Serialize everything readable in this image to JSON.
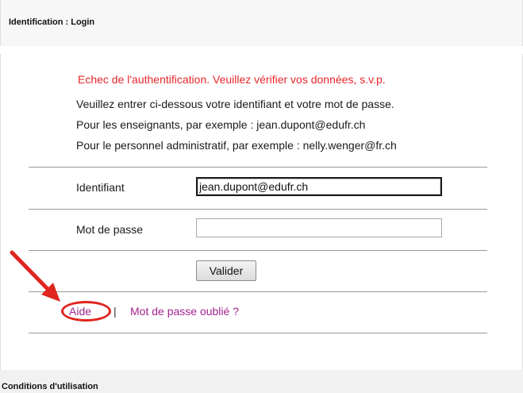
{
  "header": {
    "title": "Identification : Login"
  },
  "messages": {
    "error": "Echec de l'authentification. Veuillez vérifier vos données, s.v.p.",
    "instruction": "Veuillez entrer ci-dessous votre identifiant et votre mot de passe.",
    "example_teachers": "Pour les enseignants, par exemple : jean.dupont@edufr.ch",
    "example_admin": "Pour le personnel administratif, par exemple : nelly.wenger@fr.ch"
  },
  "form": {
    "username_label": "Identifiant",
    "username_value": "jean.dupont@edufr.ch",
    "password_label": "Mot de passe",
    "password_value": "",
    "submit_label": "Valider"
  },
  "links": {
    "help": "Aide",
    "separator": "|",
    "forgot_password": "Mot de passe oublié ?"
  },
  "footer": {
    "title": "Conditions d'utilisation"
  },
  "annotation": {
    "color": "#e0241f"
  },
  "colors": {
    "error": "#e8262b",
    "link": "#a2238e"
  }
}
